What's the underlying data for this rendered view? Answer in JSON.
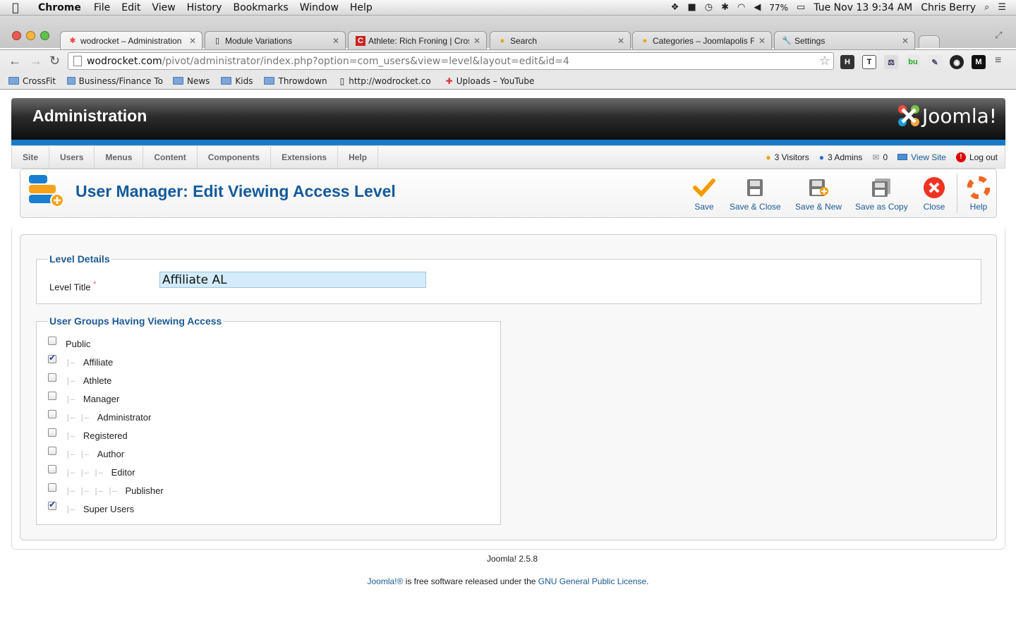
{
  "mac_menubar": {
    "app": "Chrome",
    "menus": [
      "File",
      "Edit",
      "View",
      "History",
      "Bookmarks",
      "Window",
      "Help"
    ],
    "battery": "77%",
    "clock": "Tue Nov 13  9:34 AM",
    "user": "Chris Berry"
  },
  "tabs": [
    {
      "title": "wodrocket – Administration",
      "active": true
    },
    {
      "title": "Module Variations",
      "active": false
    },
    {
      "title": "Athlete: Rich Froning | Cross",
      "active": false
    },
    {
      "title": "Search",
      "active": false
    },
    {
      "title": "Categories – Joomlapolis For",
      "active": false
    },
    {
      "title": "Settings",
      "active": false
    }
  ],
  "omnibox": {
    "host": "wodrocket.com",
    "path": "/pivot/administrator/index.php?option=com_users&view=level&layout=edit&id=4"
  },
  "bookmarks": [
    "CrossFit",
    "Business/Finance To",
    "News",
    "Kids",
    "Throwdown",
    "http://wodrocket.co",
    "Uploads – YouTube"
  ],
  "header": {
    "title": "Administration",
    "logo_text": "Joomla!"
  },
  "nav_menu": [
    "Site",
    "Users",
    "Menus",
    "Content",
    "Components",
    "Extensions",
    "Help"
  ],
  "status": {
    "visitors": "3 Visitors",
    "admins": "3 Admins",
    "messages": "0",
    "view_site": "View Site",
    "logout": "Log out"
  },
  "page_title": "User Manager: Edit Viewing Access Level",
  "toolbar": {
    "save": "Save",
    "save_close": "Save & Close",
    "save_new": "Save & New",
    "save_copy": "Save as Copy",
    "close": "Close",
    "help": "Help"
  },
  "level_details": {
    "legend": "Level Details",
    "label": "Level Title",
    "required": "*",
    "value": "Affiliate AL"
  },
  "groups": {
    "legend": "User Groups Having Viewing Access",
    "items": [
      {
        "name": "Public",
        "depth": 0,
        "checked": false
      },
      {
        "name": "Affiliate",
        "depth": 1,
        "checked": true
      },
      {
        "name": "Athlete",
        "depth": 1,
        "checked": false
      },
      {
        "name": "Manager",
        "depth": 1,
        "checked": false
      },
      {
        "name": "Administrator",
        "depth": 2,
        "checked": false
      },
      {
        "name": "Registered",
        "depth": 1,
        "checked": false
      },
      {
        "name": "Author",
        "depth": 2,
        "checked": false
      },
      {
        "name": "Editor",
        "depth": 3,
        "checked": false
      },
      {
        "name": "Publisher",
        "depth": 4,
        "checked": false
      },
      {
        "name": "Super Users",
        "depth": 1,
        "checked": true
      }
    ]
  },
  "footer": {
    "version": "Joomla! 2.5.8",
    "link1": "Joomla!®",
    "mid": " is free software released under the ",
    "link2": "GNU General Public License",
    "end": "."
  }
}
